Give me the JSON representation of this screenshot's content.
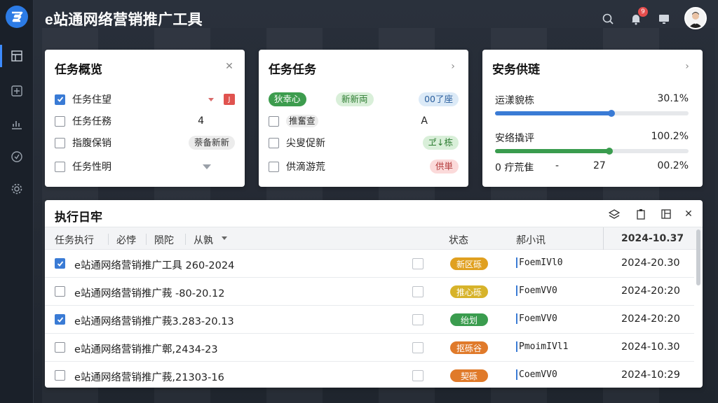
{
  "header": {
    "app_title": "e站通网络营销推广工具",
    "notification_count": "9"
  },
  "sidebar": {
    "items": [
      "dashboard",
      "add",
      "analytics",
      "check",
      "settings"
    ]
  },
  "card1": {
    "title": "任务概览",
    "rows": [
      {
        "label": "任务住望",
        "checked": true
      },
      {
        "label": "任务任務",
        "checked": false,
        "right": "4"
      },
      {
        "label": "指腹保销",
        "checked": false,
        "right": "萘备新新"
      },
      {
        "label": "任务性明",
        "checked": false
      }
    ],
    "tag_text": "J"
  },
  "card2": {
    "title": "任务任务",
    "rows": [
      {
        "left_pill": "狄幸心",
        "mid_pill": "新新両",
        "right_pill": "00了座"
      },
      {
        "label": "推奮查",
        "checked": false,
        "right": "A"
      },
      {
        "label": "尖叟促新",
        "checked": false,
        "right_pill": "ヹ↓栋"
      },
      {
        "label": "供滴游荒",
        "checked": false,
        "right_pill": "供単"
      }
    ]
  },
  "card3": {
    "title": "安务供琏",
    "progress": [
      {
        "label": "运漾貌栋",
        "value": "30.1%",
        "fraction": 0.6,
        "color": "#3a7bd5"
      },
      {
        "label": "安络撬评",
        "value": "100.2%",
        "fraction": 0.59,
        "color": "#3a9c4e"
      }
    ],
    "footer": {
      "col1": "0 疔荒隹",
      "col2": "-",
      "col3": "27",
      "col4": "00.2%"
    }
  },
  "table": {
    "title": "执行日牢",
    "columns": {
      "col1": "任务执行",
      "col2": "必悖",
      "col3": "陨陀",
      "col4": "从孰",
      "col5": "状态",
      "col6": "郝小讯",
      "col7": "2024-10.37"
    },
    "rows": [
      {
        "name": "e站通网络营销推广工具 260-2024",
        "checked": true,
        "status": "新区砾",
        "status_color": "#e0a020",
        "code": "FoemIVl0",
        "date": "2024-20.30"
      },
      {
        "name": "e站通网络营销推广莪 -80-20.12",
        "checked": false,
        "status": "推心砾",
        "status_color": "#d7b32a",
        "code": "FoemVV0",
        "date": "2024-20:20"
      },
      {
        "name": "e站通网络营销推广莪3.283-20.13",
        "checked": true,
        "status": "绐划",
        "status_color": "#3a9c4e",
        "code": "FoemVV0",
        "date": "2024-20:20"
      },
      {
        "name": "e站通网络营销推广鄣,2434-23",
        "checked": false,
        "status": "抠砾谷",
        "status_color": "#e07a2a",
        "code": "PmoimIVl1",
        "date": "2024-10.30"
      },
      {
        "name": "e站通网络营销推广莪,21303-16",
        "checked": false,
        "status": "契砾",
        "status_color": "#e07a2a",
        "code": "CoemVV0",
        "date": "2024-10:29"
      }
    ]
  }
}
